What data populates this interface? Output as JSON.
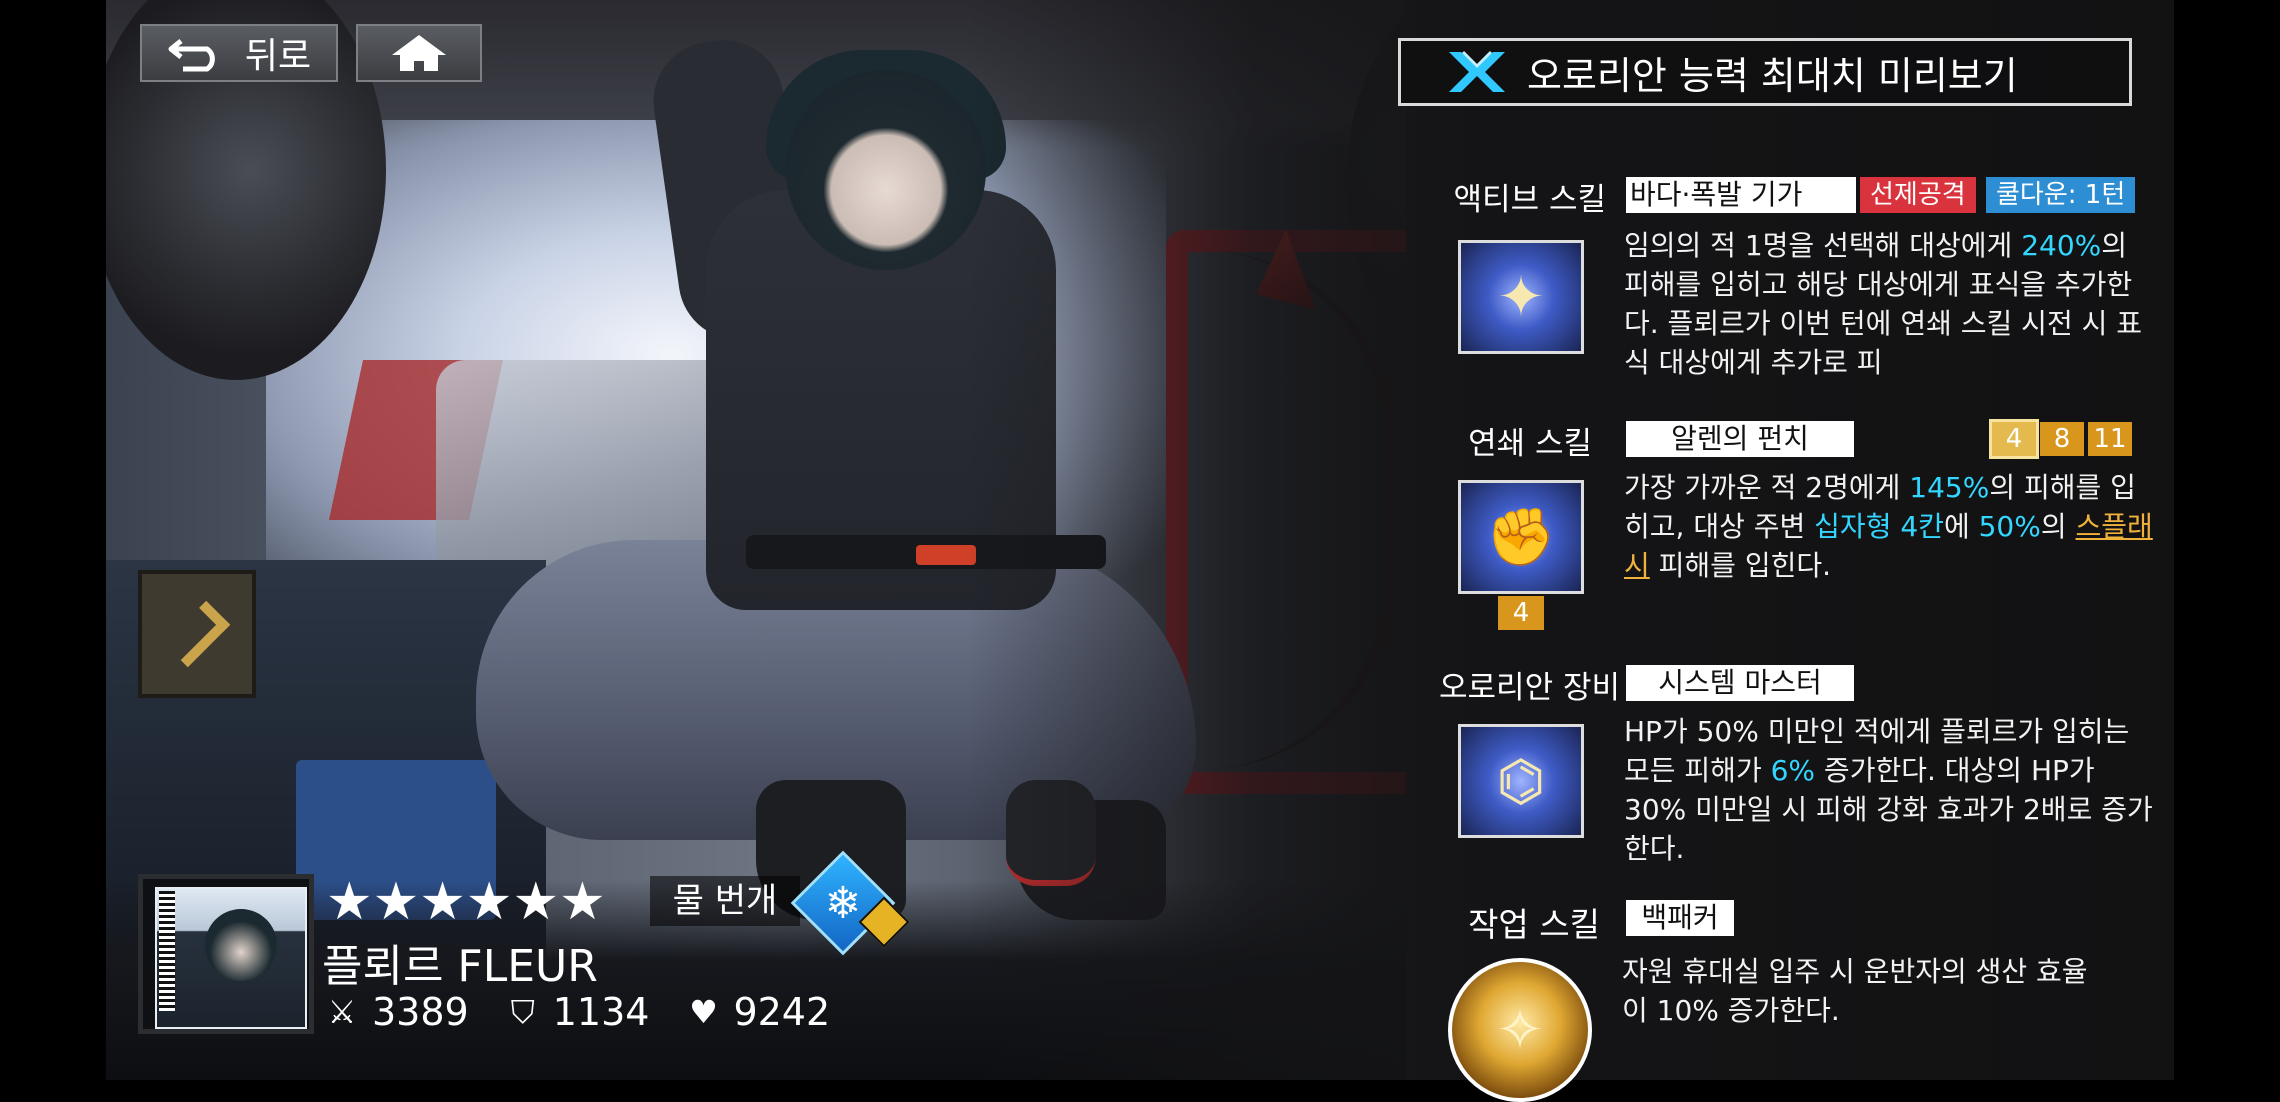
{
  "nav": {
    "back_label": "뒤로"
  },
  "panel": {
    "title": "오로리안 능력 최대치 미리보기"
  },
  "active_skill": {
    "section_label": "액티브 스킬",
    "name": "바다·폭발 기가",
    "tag_first_strike": "선제공격",
    "tag_cooldown": "쿨다운: 1턴",
    "desc_1": "임의의 적 1명을 선택해 대상에게 ",
    "desc_hl": "240%",
    "desc_2": "의 피해를 입히고 해당 대상에게 표식을 추가한다. 플뢰르가 이번 턴에 연쇄 스킬 시전 시 표식 대상에게 추가로 피"
  },
  "chain_skill": {
    "section_label": "연쇄 스킬",
    "name": "알렌의 펀치",
    "chips": [
      "4",
      "8",
      "11"
    ],
    "icon_badge": "4",
    "desc_1": "가장 가까운 적 2명에게 ",
    "hl_1": "145%",
    "desc_2": "의 피해를 입히고, 대상 주변 ",
    "hl_2": "십자형 4칸",
    "desc_3": "에 ",
    "hl_3": "50%",
    "desc_4": "의 ",
    "hl_4": "스플래시",
    "desc_5": " 피해를 입힌다."
  },
  "aurorian_gear": {
    "section_label": "오로리안 장비",
    "name": "시스템 마스터",
    "desc_1": "HP가 50% 미만인 적에게 플뢰르가 입히는 모든 피해가 ",
    "hl_1": "6%",
    "desc_2": " 증가한다. 대상의 HP가 30% 미만일 시 피해 강화 효과가 2배로 증가한다."
  },
  "work_skill": {
    "section_label": "작업 스킬",
    "name": "백패커",
    "desc": "자원 휴대실 입주 시 운반자의 생산 효율이 10% 증가한다."
  },
  "character": {
    "stars": "★★★★★★",
    "star_count": 6,
    "element_label": "물 번개",
    "element_icon": "snowflake-icon",
    "name": "플뢰르 FLEUR",
    "attack": "3389",
    "defense": "1134",
    "hp": "9242"
  },
  "colors": {
    "highlight_cyan": "#33d6ff",
    "highlight_orange": "#f0b23a",
    "tag_red": "#d9333e",
    "tag_blue": "#2e8ed3",
    "chip_gold": "#d8961c"
  }
}
